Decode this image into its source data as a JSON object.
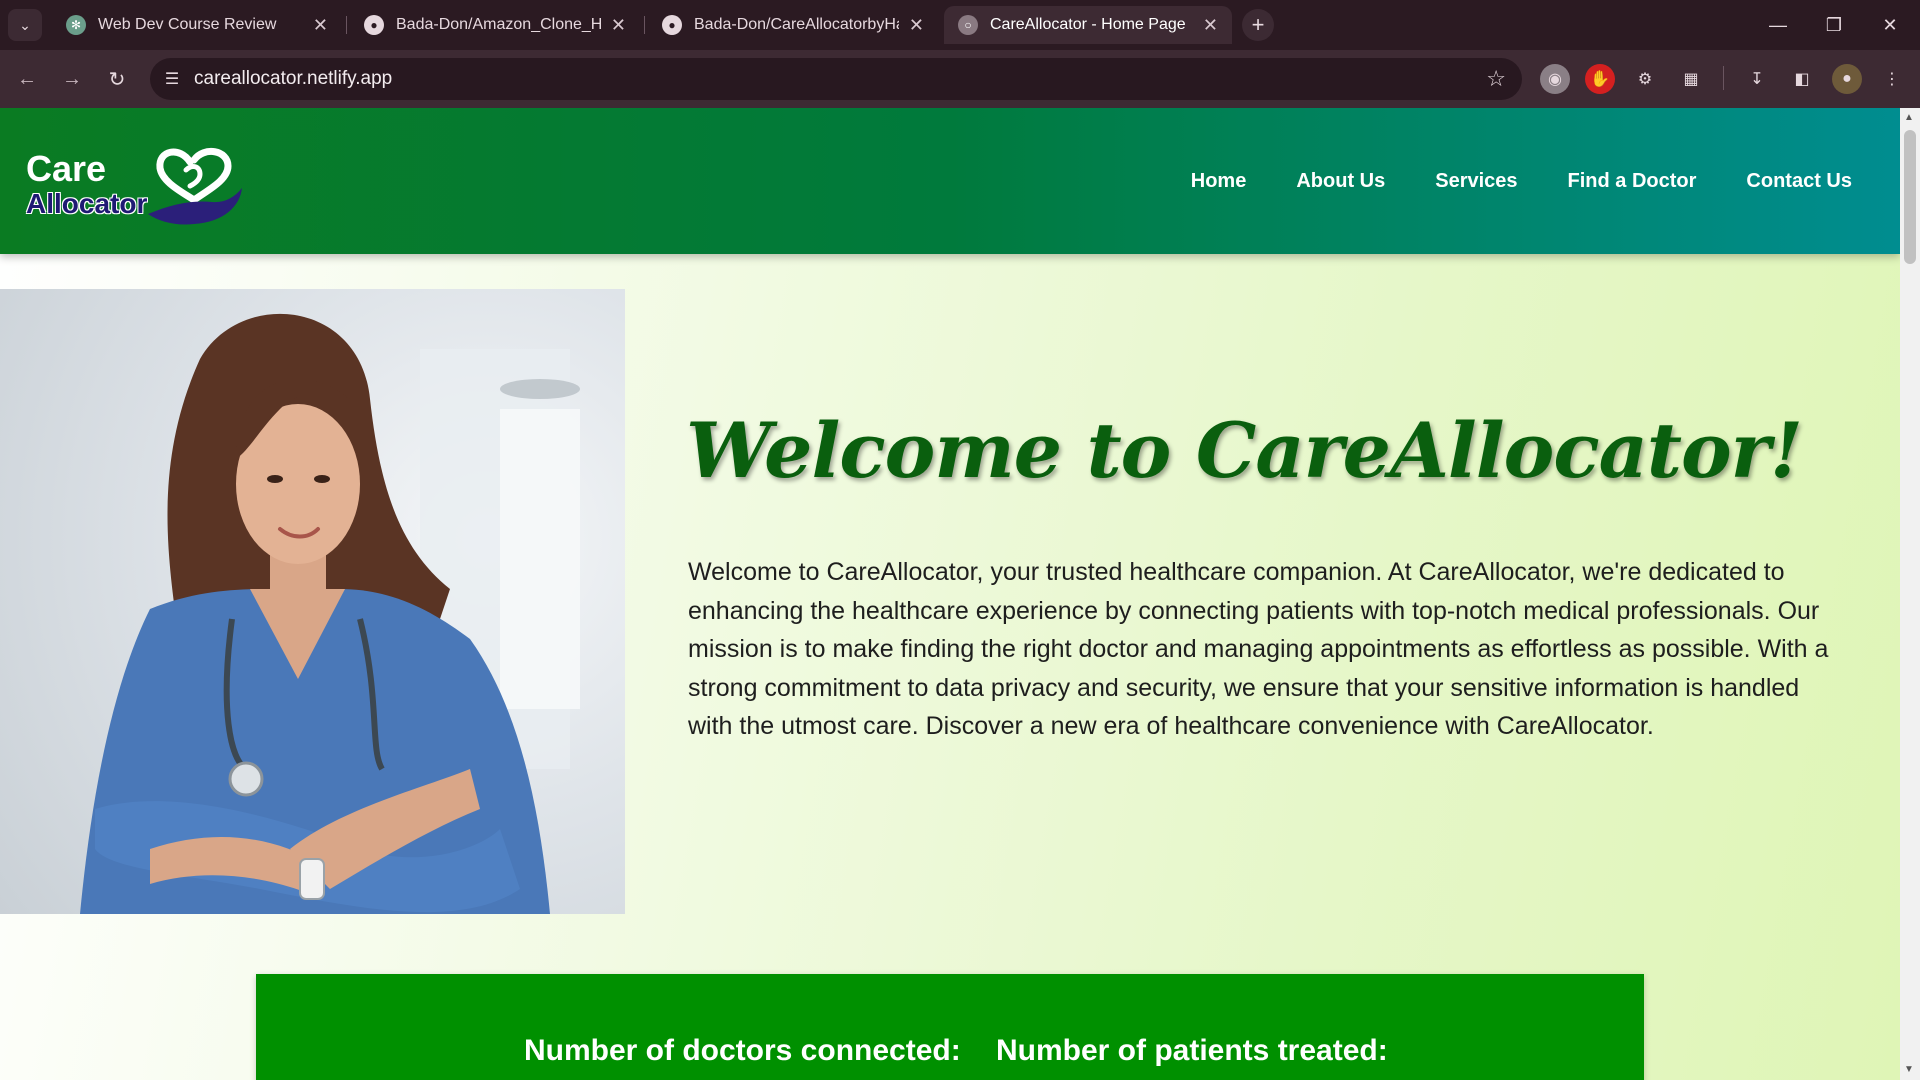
{
  "browser": {
    "tabs": [
      {
        "title": "Web Dev Course Review",
        "favicon": "chatgpt-icon",
        "active": false
      },
      {
        "title": "Bada-Don/Amazon_Clone_Har",
        "favicon": "github-icon",
        "active": false
      },
      {
        "title": "Bada-Don/CareAllocatorbyHar",
        "favicon": "github-icon",
        "active": false
      },
      {
        "title": "CareAllocator - Home Page",
        "favicon": "globe-icon",
        "active": true
      }
    ],
    "url": "careallocator.netlify.app",
    "colors": {
      "tabbar": "#2b1a22",
      "toolbar": "#3d2a33",
      "omnibox": "#281820"
    }
  },
  "site": {
    "logo": {
      "line1": "Care",
      "line2": "Allocator"
    },
    "nav": [
      "Home",
      "About Us",
      "Services",
      "Find a Doctor",
      "Contact Us"
    ],
    "hero": {
      "title": "Welcome to CareAllocator!",
      "paragraph": "Welcome to CareAllocator, your trusted healthcare companion. At CareAllocator, we're dedicated to enhancing the healthcare experience by connecting patients with top-notch medical professionals. Our mission is to make finding the right doctor and managing appointments as effortless as possible. With a strong commitment to data privacy and security, we ensure that your sensitive information is handled with the utmost care. Discover a new era of healthcare convenience with CareAllocator."
    },
    "stats": {
      "doctors_label": "Number of doctors connected:",
      "patients_label": "Number of patients treated:"
    },
    "colors": {
      "header_start": "#0a7b22",
      "header_end": "#008d90",
      "title": "#0a5f0e",
      "stats_bg": "#009000"
    }
  }
}
